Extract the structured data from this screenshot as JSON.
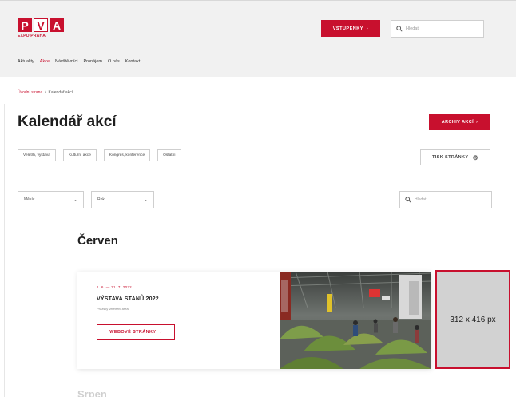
{
  "header": {
    "logo": {
      "letters": [
        "P",
        "V",
        "A"
      ],
      "subtitle": "EXPO PRAHA"
    },
    "tickets_label": "VSTUPENKY",
    "search_placeholder": "Hledat",
    "nav": [
      {
        "label": "Aktuality",
        "active": false
      },
      {
        "label": "Akce",
        "active": true
      },
      {
        "label": "Návštěvníci",
        "active": false
      },
      {
        "label": "Pronájem",
        "active": false
      },
      {
        "label": "O nás",
        "active": false
      },
      {
        "label": "Kontakt",
        "active": false
      }
    ]
  },
  "breadcrumb": {
    "home": "Úvodní strana",
    "separator": "/",
    "current": "Kalendář akcí"
  },
  "page_title": "Kalendář akcí",
  "archive_label": "ARCHIV AKCÍ",
  "filters": {
    "chips": [
      "Veletrh, výstava",
      "Kulturní akce",
      "Kongres, konference",
      "Ostatní"
    ],
    "press_label": "TISK STRÁNKY",
    "month_placeholder": "Měsíc",
    "year_placeholder": "Rok",
    "search_placeholder": "Hledat"
  },
  "month_title": "Červen",
  "event": {
    "date": "1. 6. — 31. 7. 2022",
    "name": "VÝSTAVA STANŮ 2022",
    "venue": "Pražský veletržní areál",
    "web_label": "WEBOVÉ STRÁNKY"
  },
  "ad_placeholder": "312 x 416 px",
  "next_month": "Srpen",
  "colors": {
    "accent": "#c8102e",
    "header_bg": "#f1f1f1"
  }
}
